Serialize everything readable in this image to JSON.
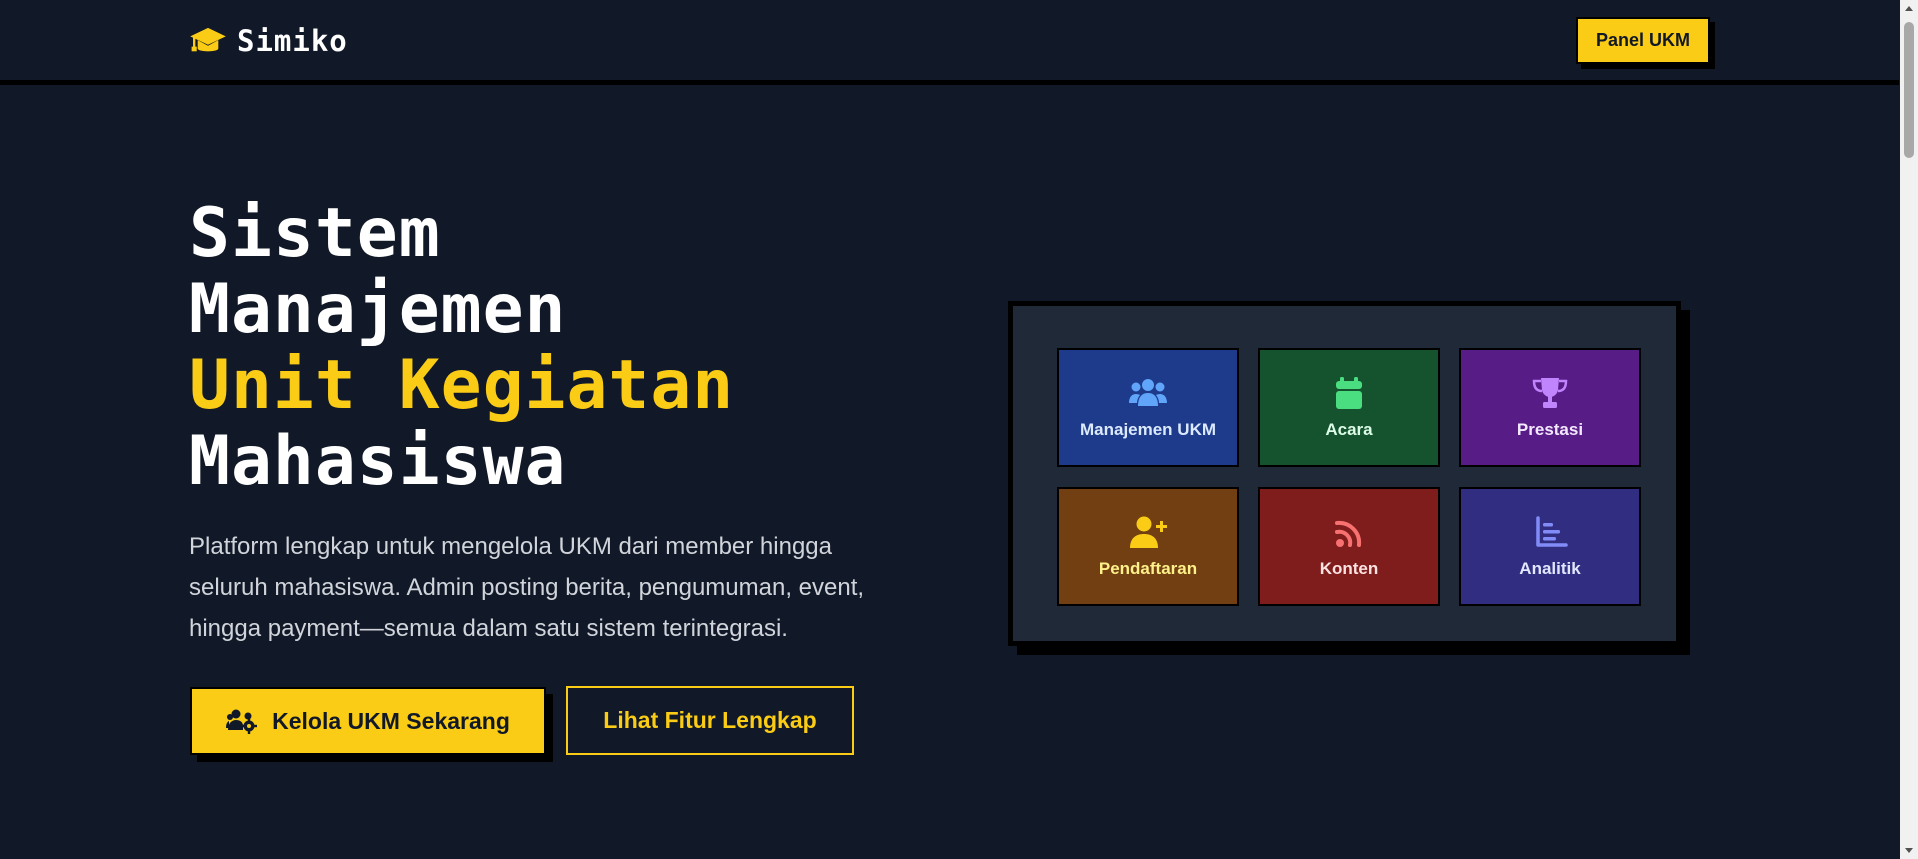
{
  "navbar": {
    "brand_icon": "graduation-cap-icon",
    "brand_name": "Simiko",
    "panel_button_label": "Panel UKM"
  },
  "hero": {
    "title_lines": [
      "Sistem",
      "Manajemen",
      "Unit Kegiatan",
      "Mahasiswa"
    ],
    "description": "Platform lengkap untuk mengelola UKM dari member hingga seluruh mahasiswa. Admin posting berita, pengumuman, event, hingga payment—semua dalam satu sistem terintegrasi.",
    "primary_button": {
      "icon": "users-gear-icon",
      "label": "Kelola UKM Sekarang"
    },
    "secondary_button": {
      "label": "Lihat Fitur Lengkap"
    }
  },
  "features": [
    {
      "label": "Manajemen UKM",
      "icon": "users-icon",
      "bg": "#1e3a8a",
      "icon_color": "#60a5fa"
    },
    {
      "label": "Acara",
      "icon": "calendar-icon",
      "bg": "#14532d",
      "icon_color": "#4ade80"
    },
    {
      "label": "Prestasi",
      "icon": "trophy-icon",
      "bg": "#581c87",
      "icon_color": "#c084fc"
    },
    {
      "label": "Pendaftaran",
      "icon": "user-plus-icon",
      "bg": "#713f12",
      "icon_color": "#facc15"
    },
    {
      "label": "Konten",
      "icon": "rss-icon",
      "bg": "#7f1d1d",
      "icon_color": "#f87171"
    },
    {
      "label": "Analitik",
      "icon": "chart-bar-icon",
      "bg": "#312e81",
      "icon_color": "#818cf8"
    }
  ],
  "colors": {
    "background": "#111827",
    "accent": "#facc15",
    "panel": "#1f2937"
  }
}
